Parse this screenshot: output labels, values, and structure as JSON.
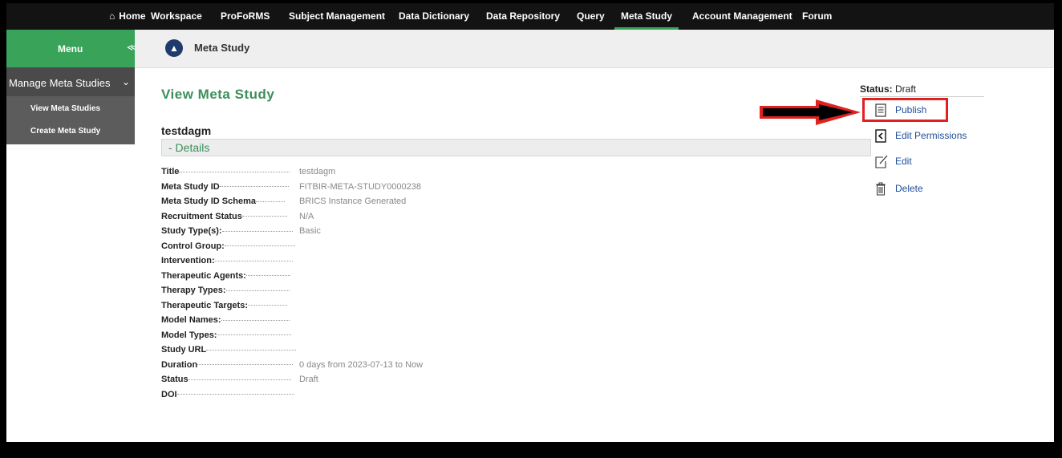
{
  "nav": {
    "home": "Home",
    "items": [
      "Workspace",
      "ProFoRMS",
      "Subject Management",
      "Data Dictionary",
      "Data Repository",
      "Query",
      "Meta Study",
      "Account Management",
      "Forum"
    ]
  },
  "menu": {
    "label": "Menu",
    "group": "Manage Meta Studies",
    "items": [
      "View Meta Studies",
      "Create Meta Study"
    ]
  },
  "subheader": {
    "title": "Meta Study"
  },
  "page": {
    "title": "View Meta Study",
    "study_name": "testdagm",
    "details_label": "- Details"
  },
  "details": [
    {
      "k": "Title",
      "v": "testdagm"
    },
    {
      "k": "Meta Study ID",
      "v": "FITBIR-META-STUDY0000238"
    },
    {
      "k": "Meta Study ID Schema",
      "v": "BRICS Instance Generated"
    },
    {
      "k": "Recruitment Status",
      "v": "N/A"
    },
    {
      "k": "Study Type(s):",
      "v": "Basic"
    },
    {
      "k": "Control Group:",
      "v": ""
    },
    {
      "k": "Intervention:",
      "v": ""
    },
    {
      "k": "Therapeutic Agents:",
      "v": ""
    },
    {
      "k": "Therapy Types:",
      "v": ""
    },
    {
      "k": "Therapeutic Targets:",
      "v": ""
    },
    {
      "k": "Model Names:",
      "v": ""
    },
    {
      "k": "Model Types:",
      "v": ""
    },
    {
      "k": "Study URL",
      "v": ""
    },
    {
      "k": "Duration",
      "v": "0 days from 2023-07-13 to Now"
    },
    {
      "k": "Status",
      "v": "Draft"
    },
    {
      "k": "DOI",
      "v": ""
    }
  ],
  "side_panel": {
    "status_label": "Status:",
    "status_value": "Draft",
    "actions": [
      "Publish",
      "Edit Permissions",
      "Edit",
      "Delete"
    ]
  },
  "icons": {
    "home": "home-icon",
    "subheader": "meta-study-icon",
    "publish": "document-icon",
    "permissions": "share-icon",
    "edit": "pencil-icon",
    "delete": "trash-icon"
  },
  "colors": {
    "accent_green": "#3aa35a",
    "highlight_red": "#e0211f",
    "link_blue": "#1f4e9a"
  }
}
